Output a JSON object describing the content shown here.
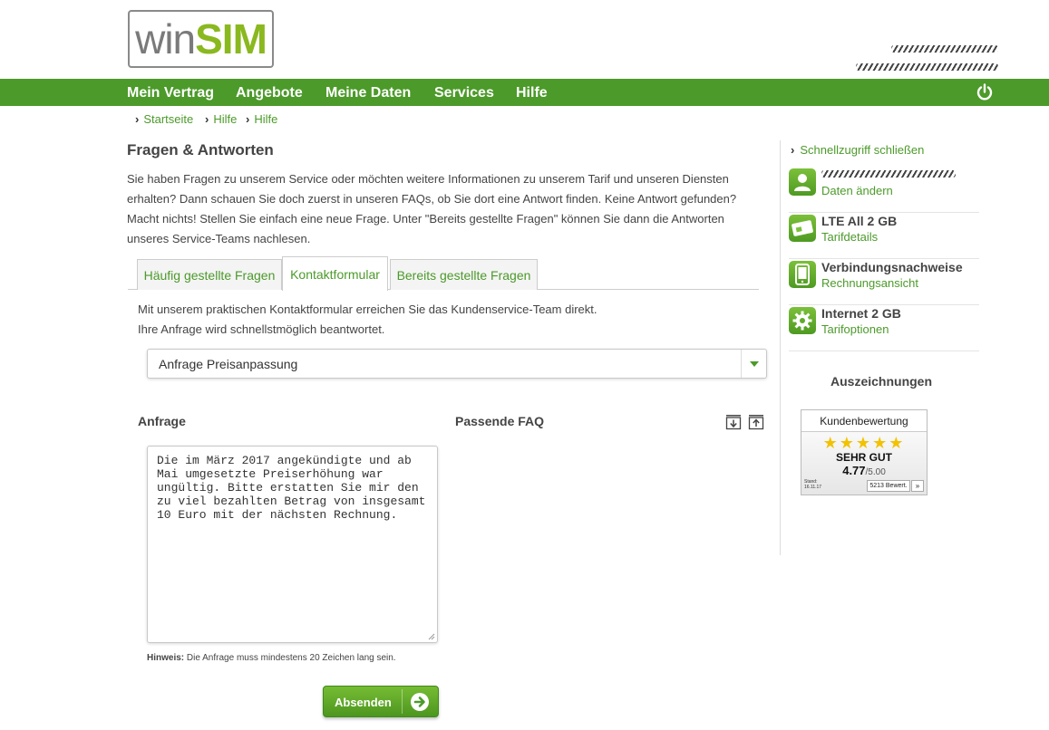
{
  "brand": {
    "name_part1": "win",
    "name_part2": "SIM"
  },
  "nav": {
    "items": [
      "Mein Vertrag",
      "Angebote",
      "Meine Daten",
      "Services",
      "Hilfe"
    ]
  },
  "breadcrumb": [
    "Startseite",
    "Hilfe",
    "Hilfe"
  ],
  "page": {
    "title": "Fragen & Antworten",
    "intro": "Sie haben Fragen zu unserem Service oder möchten weitere Informationen zu unserem Tarif und unseren Diensten erhalten? Dann schauen Sie doch zuerst in unseren FAQs, ob Sie dort eine Antwort finden. Keine Antwort gefunden? Macht nichts! Stellen Sie einfach eine neue Frage. Unter \"Bereits gestellte Fragen\" können Sie dann die Antworten unseres Service-Teams nachlesen."
  },
  "tabs": [
    {
      "label": "Häufig gestellte Fragen",
      "active": false
    },
    {
      "label": "Kontaktformular",
      "active": true
    },
    {
      "label": "Bereits gestellte Fragen",
      "active": false
    }
  ],
  "form": {
    "desc_line1": "Mit unserem praktischen Kontaktformular erreichen Sie das Kundenservice-Team direkt.",
    "desc_line2": "Ihre Anfrage wird schnellstmöglich beantwortet.",
    "topic_selected": "Anfrage Preisanpassung",
    "request_label": "Anfrage",
    "faq_label": "Passende FAQ",
    "request_text": "Die im März 2017 angekündigte und ab Mai umgesetzte Preiserhöhung war ungültig. Bitte erstatten Sie mir den zu viel bezahlten Betrag von insgesamt 10 Euro mit der nächsten Rechnung.",
    "hint_label": "Hinweis:",
    "hint_text": "Die Anfrage muss mindestens 20 Zeichen lang sein.",
    "submit_label": "Absenden"
  },
  "sidebar": {
    "quick_access": "Schnellzugriff schließen",
    "items": [
      {
        "title": "",
        "link": "Daten ändern",
        "icon": "user-icon"
      },
      {
        "title": "LTE All 2 GB",
        "link": "Tarifdetails",
        "icon": "sim-card-icon"
      },
      {
        "title": "Verbindungsnachweise",
        "link": "Rechnungsansicht",
        "icon": "phone-icon"
      },
      {
        "title": "Internet 2 GB",
        "link": "Tarifoptionen",
        "icon": "gear-icon"
      }
    ],
    "awards_title": "Auszeichnungen",
    "badge": {
      "header": "Kundenbewertung",
      "stars": "★★★★★",
      "grade": "SEHR GUT",
      "score": "4.77",
      "score_max": "/5.00",
      "stand_label": "Stand:",
      "stand_date": "16.11.17",
      "reviews": "5213 Bewert.",
      "more": "»"
    }
  },
  "colors": {
    "brand_green": "#4c9a2a",
    "logo_green": "#8ab81f"
  }
}
